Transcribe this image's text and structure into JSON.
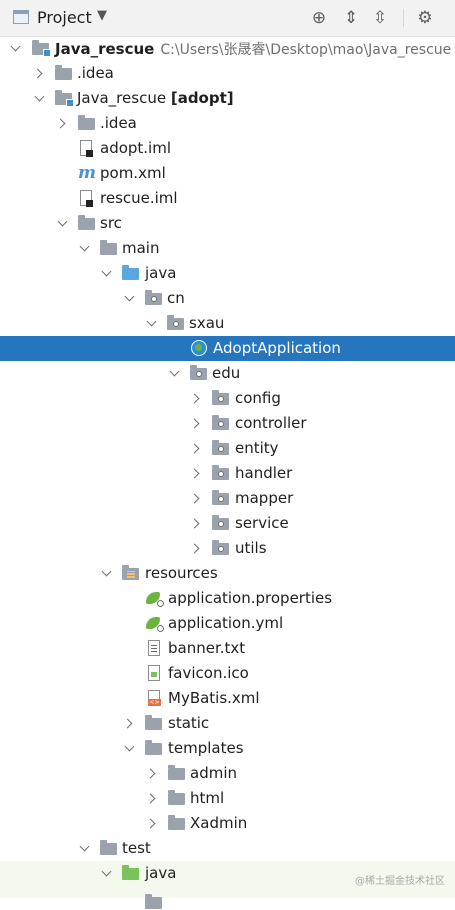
{
  "header": {
    "title": "Project",
    "caret_icon": "triangle-down-icon",
    "tools": [
      "locate-crosshair-icon",
      "expand-all-icon",
      "collapse-all-icon",
      "close-icon",
      "gear-icon"
    ]
  },
  "colors": {
    "selection": "#2675bf",
    "folder": "#9aa3ad",
    "source_folder": "#5aa7de",
    "test_folder": "#7ac35c",
    "test_row_bg": "#f3f9ed"
  },
  "tree": [
    {
      "label": "Java_rescue",
      "bold": true,
      "path": "C:\\Users\\张晟睿\\Desktop\\mao\\Java_rescue",
      "expanded": true,
      "icon": "module-folder"
    },
    {
      "label": ".idea",
      "expanded": false,
      "icon": "folder"
    },
    {
      "label": "Java_rescue",
      "suffix": "[adopt]",
      "expanded": true,
      "icon": "module-folder"
    },
    {
      "label": ".idea",
      "expanded": false,
      "icon": "folder"
    },
    {
      "label": "adopt.iml",
      "icon": "iml-file"
    },
    {
      "label": "pom.xml",
      "icon": "maven-file"
    },
    {
      "label": "rescue.iml",
      "icon": "iml-file"
    },
    {
      "label": "src",
      "expanded": true,
      "icon": "folder"
    },
    {
      "label": "main",
      "expanded": true,
      "icon": "folder"
    },
    {
      "label": "java",
      "expanded": true,
      "icon": "source-folder"
    },
    {
      "label": "cn",
      "expanded": true,
      "icon": "package"
    },
    {
      "label": "sxau",
      "expanded": true,
      "icon": "package"
    },
    {
      "label": "AdoptApplication",
      "selected": true,
      "icon": "spring-app"
    },
    {
      "label": "edu",
      "expanded": true,
      "icon": "package"
    },
    {
      "label": "config",
      "expanded": false,
      "icon": "package"
    },
    {
      "label": "controller",
      "expanded": false,
      "icon": "package"
    },
    {
      "label": "entity",
      "expanded": false,
      "icon": "package"
    },
    {
      "label": "handler",
      "expanded": false,
      "icon": "package"
    },
    {
      "label": "mapper",
      "expanded": false,
      "icon": "package"
    },
    {
      "label": "service",
      "expanded": false,
      "icon": "package"
    },
    {
      "label": "utils",
      "expanded": false,
      "icon": "package"
    },
    {
      "label": "resources",
      "expanded": true,
      "icon": "resources-folder"
    },
    {
      "label": "application.properties",
      "icon": "spring-config"
    },
    {
      "label": "application.yml",
      "icon": "spring-config"
    },
    {
      "label": "banner.txt",
      "icon": "text-file"
    },
    {
      "label": "favicon.ico",
      "icon": "image-file"
    },
    {
      "label": "MyBatis.xml",
      "icon": "xml-file"
    },
    {
      "label": "static",
      "expanded": false,
      "icon": "folder"
    },
    {
      "label": "templates",
      "expanded": true,
      "icon": "folder"
    },
    {
      "label": "admin",
      "expanded": false,
      "icon": "folder"
    },
    {
      "label": "html",
      "expanded": false,
      "icon": "folder"
    },
    {
      "label": "Xadmin",
      "expanded": false,
      "icon": "folder"
    },
    {
      "label": "test",
      "expanded": true,
      "icon": "folder"
    },
    {
      "label": "java",
      "expanded": true,
      "icon": "test-folder"
    }
  ],
  "watermark": "@稀土掘金技术社区"
}
